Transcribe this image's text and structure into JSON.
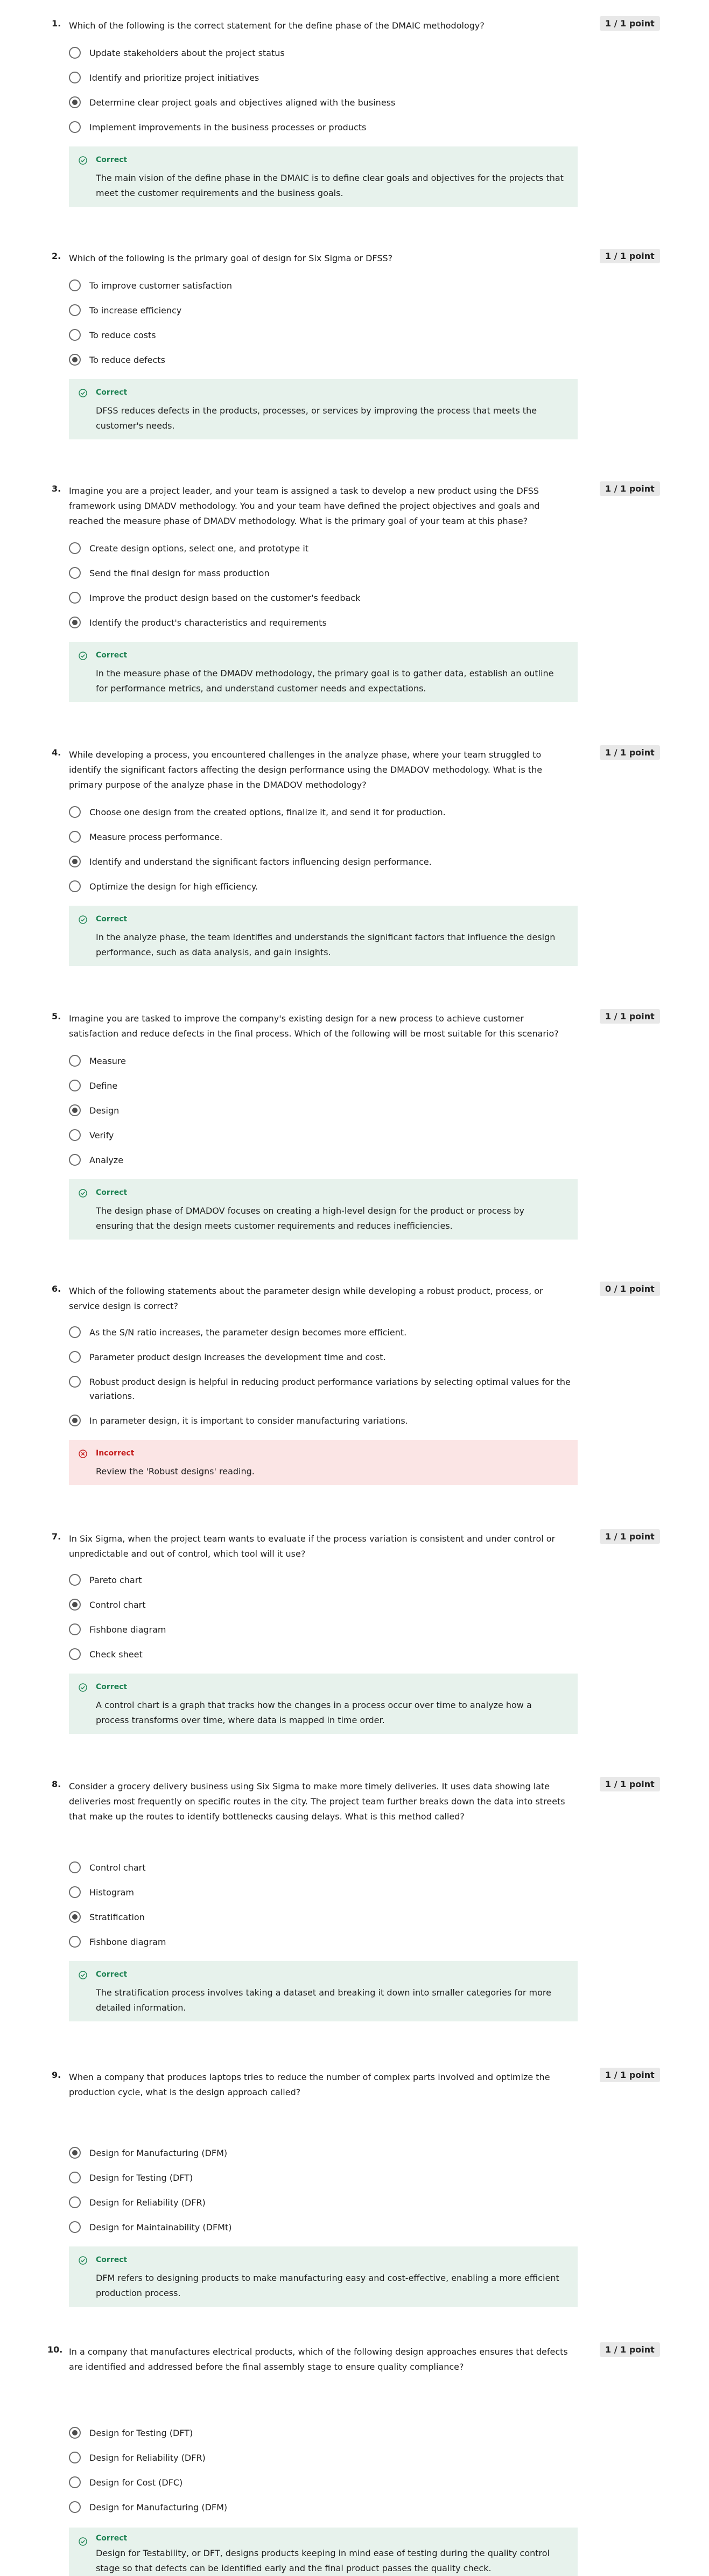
{
  "questions": [
    {
      "number": "1.",
      "text": "Which of the following is the correct statement for the define phase of the DMAIC methodology?",
      "points": "1 / 1 point",
      "options": [
        {
          "label": "Update stakeholders about the project status",
          "selected": false
        },
        {
          "label": "Identify and prioritize project initiatives",
          "selected": false
        },
        {
          "label": "Determine clear project goals and objectives aligned with the business",
          "selected": true
        },
        {
          "label": "Implement improvements in the business processes or products",
          "selected": false
        }
      ],
      "feedback": {
        "status": "Correct",
        "correct": true,
        "text": "The main vision of the define phase in the DMAIC is to define clear goals and objectives for the projects that meet the customer requirements and the business goals."
      }
    },
    {
      "number": "2.",
      "text": "Which of the following is the primary goal of design for Six Sigma or DFSS?",
      "points": "1 / 1 point",
      "options": [
        {
          "label": "To improve customer satisfaction",
          "selected": false
        },
        {
          "label": "To increase efficiency",
          "selected": false
        },
        {
          "label": "To reduce costs",
          "selected": false
        },
        {
          "label": "To reduce defects",
          "selected": true
        }
      ],
      "feedback": {
        "status": "Correct",
        "correct": true,
        "text": "DFSS reduces defects in the products, processes, or services by improving the process that meets the customer's needs."
      }
    },
    {
      "number": "3.",
      "text": "Imagine you are a project leader, and your team is assigned a task to develop a new product using the DFSS framework using DMADV methodology. You and your team have defined the project objectives and goals and reached the measure phase of DMADV methodology. What is the primary goal of your team at this phase?",
      "points": "1 / 1 point",
      "options": [
        {
          "label": "Create design options, select one, and prototype it",
          "selected": false
        },
        {
          "label": "Send the final design for mass production",
          "selected": false
        },
        {
          "label": "Improve the product design based on the customer's feedback",
          "selected": false
        },
        {
          "label": "Identify the product's characteristics and requirements",
          "selected": true
        }
      ],
      "feedback": {
        "status": "Correct",
        "correct": true,
        "text": "In the measure phase of the DMADV methodology, the primary goal is to gather data, establish an outline for performance metrics, and understand customer needs and expectations."
      }
    },
    {
      "number": "4.",
      "text": "While developing a process, you encountered challenges in the analyze phase, where your team struggled to identify the significant factors affecting the design performance using the DMADOV methodology. What is the primary purpose of the analyze phase in the DMADOV methodology?",
      "points": "1 / 1 point",
      "options": [
        {
          "label": "Choose one design from the created options, finalize it, and send it for production.",
          "selected": false
        },
        {
          "label": "Measure process performance.",
          "selected": false
        },
        {
          "label": "Identify and understand the significant factors influencing design performance.",
          "selected": true
        },
        {
          "label": "Optimize the design for high efficiency.",
          "selected": false
        }
      ],
      "feedback": {
        "status": "Correct",
        "correct": true,
        "text": "In the analyze phase, the team identifies and understands the significant factors that influence the design performance, such as data analysis, and gain insights."
      }
    },
    {
      "number": "5.",
      "text": "Imagine you are tasked to improve the company's existing design for a new process to achieve customer satisfaction and reduce defects in the final process. Which of the following will be most suitable for this scenario?",
      "points": "1 / 1 point",
      "options": [
        {
          "label": "Measure",
          "selected": false
        },
        {
          "label": "Define",
          "selected": false
        },
        {
          "label": "Design",
          "selected": true
        },
        {
          "label": "Verify",
          "selected": false
        },
        {
          "label": "Analyze",
          "selected": false
        }
      ],
      "feedback": {
        "status": "Correct",
        "correct": true,
        "text": "The design phase of DMADOV focuses on creating a high-level design for the product or process by ensuring that the design meets customer requirements and reduces inefficiencies."
      }
    },
    {
      "number": "6.",
      "text": "Which of the following statements about the parameter design while developing a robust product, process, or service design is correct?",
      "points": "0 / 1 point",
      "options": [
        {
          "label": "As the S/N ratio increases, the parameter design becomes more efficient.",
          "selected": false
        },
        {
          "label": "Parameter product design increases the development time and cost.",
          "selected": false
        },
        {
          "label": "Robust product design is helpful in reducing product performance variations by selecting optimal values for the variations.",
          "selected": false
        },
        {
          "label": "In parameter design, it is important to consider manufacturing variations.",
          "selected": true
        }
      ],
      "feedback": {
        "status": "Incorrect",
        "correct": false,
        "text": "Review the 'Robust designs' reading."
      }
    },
    {
      "number": "7.",
      "text": "In Six Sigma, when the project team wants to evaluate if the process variation is consistent and under control or unpredictable and out of control, which tool will it use?",
      "points": "1 / 1 point",
      "options": [
        {
          "label": "Pareto chart",
          "selected": false
        },
        {
          "label": "Control chart",
          "selected": true
        },
        {
          "label": "Fishbone diagram",
          "selected": false
        },
        {
          "label": "Check sheet",
          "selected": false
        }
      ],
      "feedback": {
        "status": "Correct",
        "correct": true,
        "text": "A control chart is a graph that tracks how the changes in a process occur over time to analyze how a process transforms over time, where data is mapped in time order."
      }
    },
    {
      "number": "8.",
      "text": "Consider a grocery delivery business using Six Sigma to make more timely deliveries. It uses data showing late deliveries most frequently on specific routes in the city. The project team further breaks down the data into streets that make up the routes to identify bottlenecks causing delays. What is this method called?",
      "points": "1 / 1 point",
      "options": [
        {
          "label": "Control chart",
          "selected": false
        },
        {
          "label": "Histogram",
          "selected": false
        },
        {
          "label": "Stratification",
          "selected": true
        },
        {
          "label": "Fishbone diagram",
          "selected": false
        }
      ],
      "feedback": {
        "status": "Correct",
        "correct": true,
        "text": "The stratification process involves taking a dataset and breaking it down into smaller categories for more detailed information."
      }
    },
    {
      "number": "9.",
      "text": "When a company that produces laptops tries to reduce the number of complex parts involved and optimize the production cycle, what is the design approach called?",
      "points": "1 / 1 point",
      "options": [
        {
          "label": "Design for Manufacturing (DFM)",
          "selected": true
        },
        {
          "label": "Design for Testing (DFT)",
          "selected": false
        },
        {
          "label": "Design for Reliability (DFR)",
          "selected": false
        },
        {
          "label": "Design for Maintainability (DFMt)",
          "selected": false
        }
      ],
      "feedback": {
        "status": "Correct",
        "correct": true,
        "text": "DFM refers to designing products to make manufacturing easy and cost-effective, enabling a more efficient production process."
      }
    },
    {
      "number": "10.",
      "text": "In a company that manufactures electrical products, which of the following design approaches ensures that defects are identified and addressed before the final assembly stage to ensure quality compliance?",
      "points": "1 / 1 point",
      "options": [
        {
          "label": "Design for Testing (DFT)",
          "selected": true
        },
        {
          "label": "Design for Reliability (DFR)",
          "selected": false
        },
        {
          "label": "Design for Cost (DFC)",
          "selected": false
        },
        {
          "label": "Design for Manufacturing (DFM)",
          "selected": false
        }
      ],
      "feedback": {
        "status": "Correct",
        "correct": true,
        "text": "Design for Testability, or DFT, designs products keeping in mind ease of testing during the quality control stage so that defects can be identified early and the final product passes the quality check."
      }
    }
  ]
}
